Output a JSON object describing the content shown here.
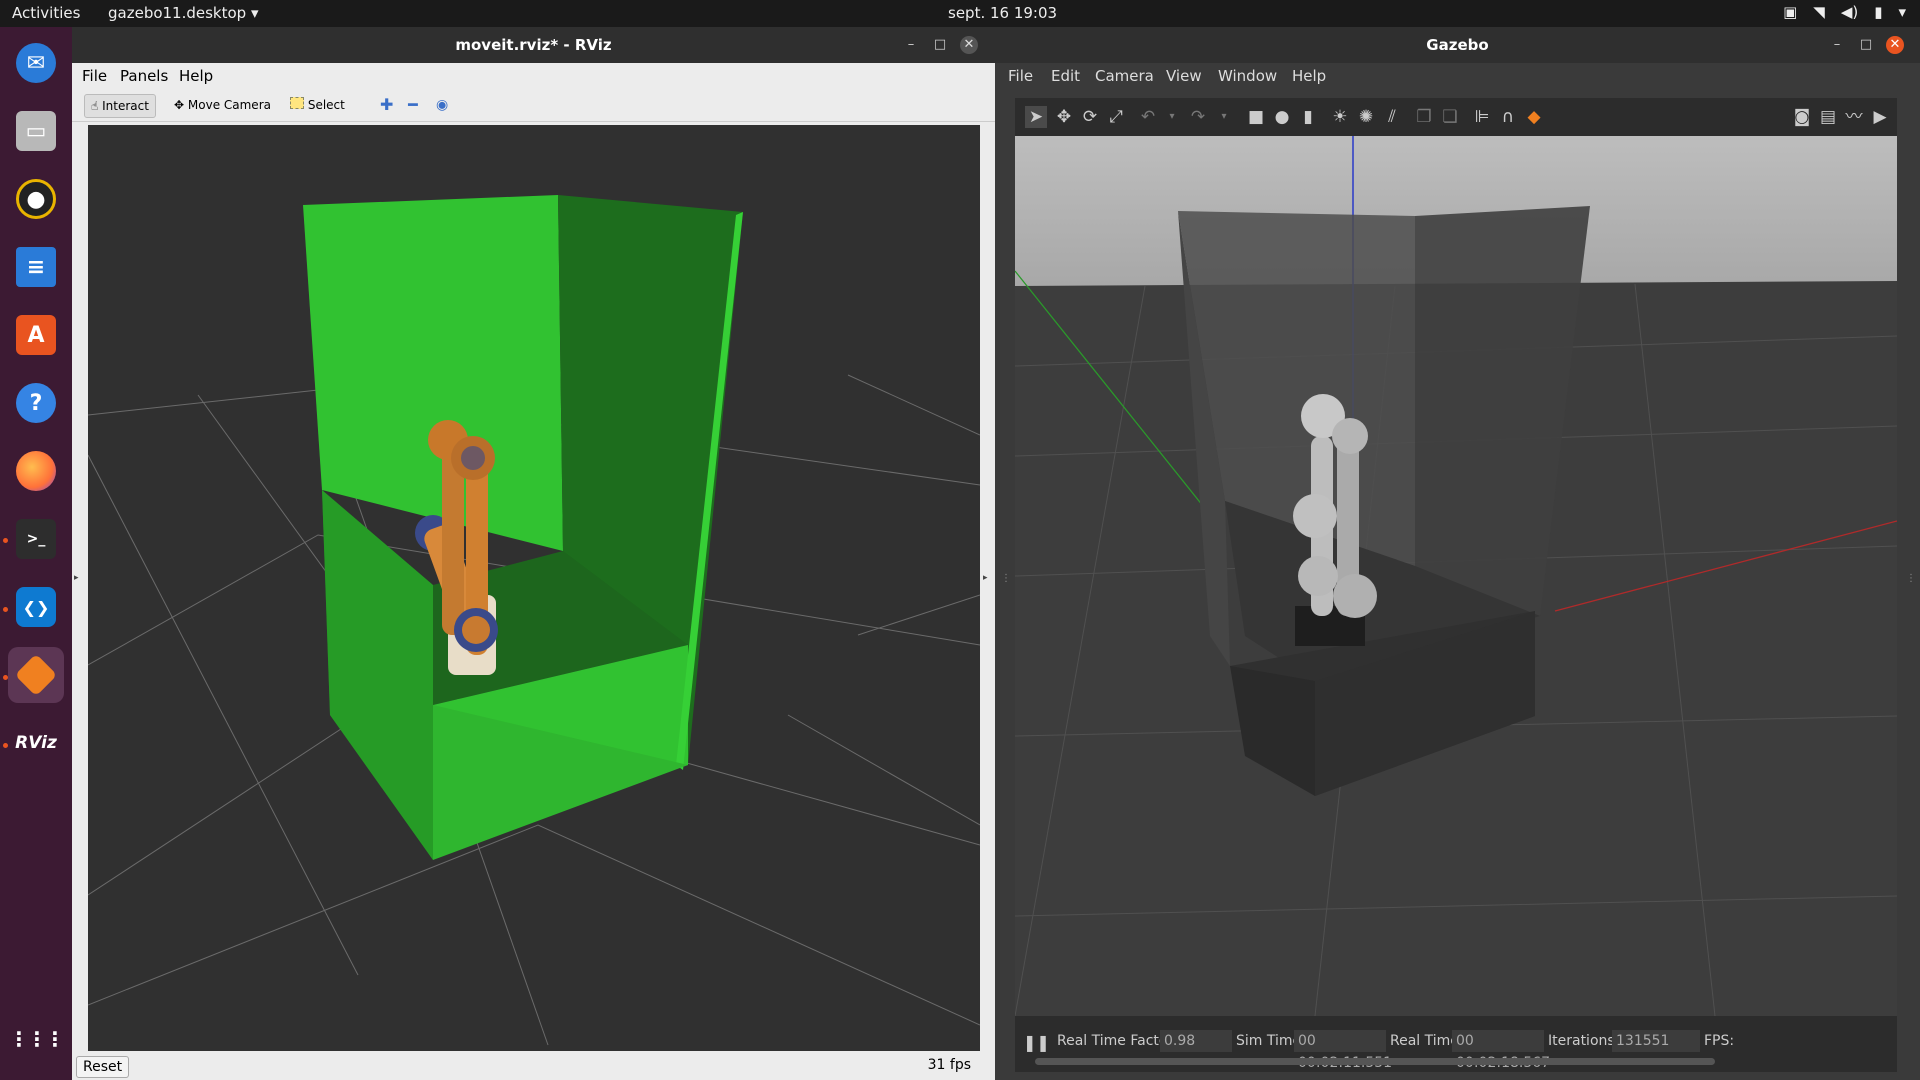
{
  "topbar": {
    "activities": "Activities",
    "app_menu": "gazebo11.desktop",
    "clock": "sept. 16  19:03"
  },
  "dock": {
    "items": [
      {
        "name": "thunderbird",
        "glyph": "✉",
        "color": "#2a7bd8"
      },
      {
        "name": "files",
        "glyph": "▭",
        "color": "#b8b8b8"
      },
      {
        "name": "rhythmbox",
        "glyph": "◉",
        "color": "#e9b400"
      },
      {
        "name": "writer",
        "glyph": "≡",
        "color": "#2a7bd8"
      },
      {
        "name": "software",
        "glyph": "A",
        "color": "#e95420"
      },
      {
        "name": "help",
        "glyph": "?",
        "color": "#3584e4"
      },
      {
        "name": "firefox",
        "glyph": "◔",
        "color": "#ff7139"
      },
      {
        "name": "terminal",
        "glyph": ">_",
        "color": "#2d2d2d"
      },
      {
        "name": "vscode",
        "glyph": "❮❯",
        "color": "#0e7ad1"
      },
      {
        "name": "gazebo",
        "glyph": "◆",
        "color": "#f08020"
      },
      {
        "name": "rviz",
        "glyph": "RViz",
        "color": "#3c1a33"
      }
    ],
    "apps_grid_glyph": "⋮⋮⋮"
  },
  "rviz": {
    "title": "moveit.rviz* - RViz",
    "menu": [
      "File",
      "Panels",
      "Help"
    ],
    "tools": {
      "interact": "Interact",
      "move_camera": "Move Camera",
      "select": "Select"
    },
    "reset": "Reset",
    "fps": "31 fps"
  },
  "gazebo": {
    "title": "Gazebo",
    "menu": [
      "File",
      "Edit",
      "Camera",
      "View",
      "Window",
      "Help"
    ],
    "status": {
      "rtf_label": "Real Time Factor:",
      "rtf_value": "0.98",
      "sim_label": "Sim Time:",
      "sim_value": "00 00:02:11.551",
      "real_label": "Real Time:",
      "real_value": "00 00:02:18.567",
      "iter_label": "Iterations:",
      "iter_value": "131551",
      "fps_label": "FPS:"
    }
  },
  "colors": {
    "enclosure_green": "#2fbf2f",
    "enclosure_dark": "#1f6a1f",
    "robot_orange": "#d08030",
    "gazebo_grey": "#4a4a4a"
  }
}
